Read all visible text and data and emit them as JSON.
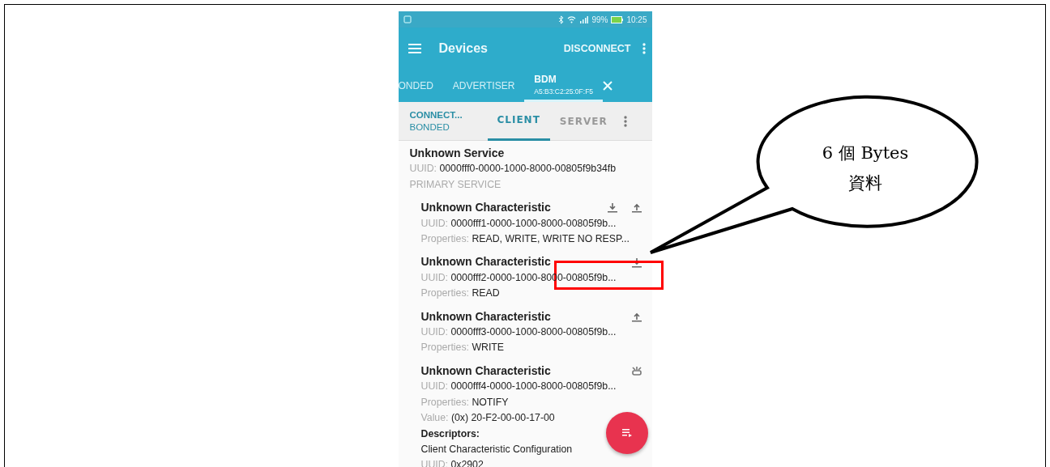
{
  "status_bar": {
    "battery": "99%",
    "time": "10:25"
  },
  "toolbar": {
    "title": "Devices",
    "action": "DISCONNECT"
  },
  "device_tabs": [
    {
      "label": "ONDED",
      "selected": false
    },
    {
      "label": "ADVERTISER",
      "selected": false
    },
    {
      "label": "BDM",
      "subtitle": "A5:B3:C2:25:0F:F5",
      "selected": true
    }
  ],
  "connection": {
    "state": "CONNECT...",
    "bond": "BONDED"
  },
  "view_tabs": [
    {
      "label": "CLIENT",
      "selected": true
    },
    {
      "label": "SERVER",
      "selected": false
    }
  ],
  "service": {
    "name": "Unknown Service",
    "uuid_label": "UUID:",
    "uuid": "0000fff0-0000-1000-8000-00805f9b34fb",
    "type": "PRIMARY SERVICE"
  },
  "characteristics": [
    {
      "name": "Unknown Characteristic",
      "uuid_label": "UUID:",
      "uuid": "0000fff1-0000-1000-8000-00805f9b...",
      "properties_label": "Properties:",
      "properties": "READ, WRITE, WRITE NO RESP...",
      "actions": [
        {
          "kind": "read"
        },
        {
          "kind": "write"
        }
      ]
    },
    {
      "name": "Unknown Characteristic",
      "uuid_label": "UUID:",
      "uuid": "0000fff2-0000-1000-8000-00805f9b...",
      "properties_label": "Properties:",
      "properties": "READ",
      "actions": [
        {
          "kind": "read"
        }
      ]
    },
    {
      "name": "Unknown Characteristic",
      "uuid_label": "UUID:",
      "uuid": "0000fff3-0000-1000-8000-00805f9b...",
      "properties_label": "Properties:",
      "properties": "WRITE",
      "actions": [
        {
          "kind": "write"
        }
      ]
    },
    {
      "name": "Unknown Characteristic",
      "uuid_label": "UUID:",
      "uuid": "0000fff4-0000-1000-8000-00805f9b...",
      "properties_label": "Properties:",
      "properties": "NOTIFY",
      "actions": [
        {
          "kind": "notify"
        }
      ],
      "value_label": "Value:",
      "value": "(0x) 20-F2-00-00-17-00",
      "descriptors_label": "Descriptors:",
      "descriptor": {
        "name": "Client Characteristic Configuration",
        "uuid_label": "UUID:",
        "uuid": "0x2902"
      }
    }
  ],
  "callout": {
    "lines": [
      "6 個 Bytes",
      "資料"
    ]
  }
}
